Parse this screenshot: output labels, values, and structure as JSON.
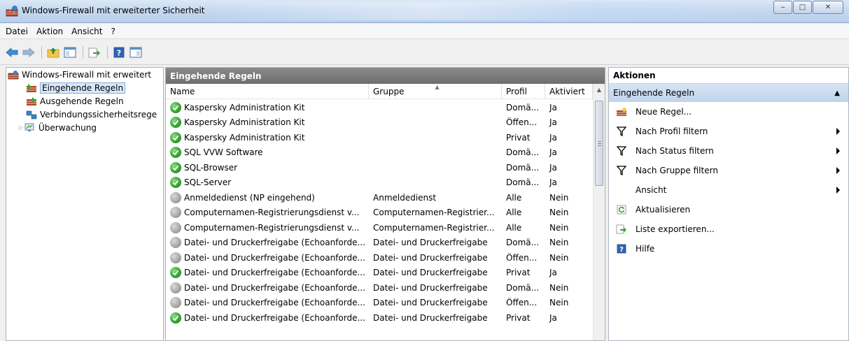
{
  "window": {
    "title": "Windows-Firewall mit erweiterter Sicherheit",
    "buttons": {
      "minimize": "‒",
      "maximize": "□",
      "close": "✕"
    }
  },
  "menu": [
    "Datei",
    "Aktion",
    "Ansicht",
    "?"
  ],
  "toolbar": {
    "icons": [
      "back-arrow-icon",
      "forward-arrow-icon",
      "up-folder-icon",
      "show-hide-console-tree-icon",
      "export-list-icon",
      "help-icon",
      "show-hide-action-pane-icon"
    ]
  },
  "tree": {
    "root": "Windows-Firewall mit erweitert",
    "items": [
      {
        "label": "Eingehende Regeln",
        "selected": true
      },
      {
        "label": "Ausgehende Regeln",
        "selected": false
      },
      {
        "label": "Verbindungssicherheitsrege",
        "selected": false
      },
      {
        "label": "Überwachung",
        "selected": false,
        "expandable": true
      }
    ]
  },
  "main": {
    "header": "Eingehende Regeln",
    "columns": [
      "Name",
      "Gruppe",
      "Profil",
      "Aktiviert"
    ],
    "rows": [
      {
        "name": "Kaspersky Administration Kit",
        "group": "",
        "profile": "Domä...",
        "active": "Ja",
        "enabled": true
      },
      {
        "name": "Kaspersky Administration Kit",
        "group": "",
        "profile": "Öffen...",
        "active": "Ja",
        "enabled": true
      },
      {
        "name": "Kaspersky Administration Kit",
        "group": "",
        "profile": "Privat",
        "active": "Ja",
        "enabled": true
      },
      {
        "name": "SQL VVW Software",
        "group": "",
        "profile": "Domä...",
        "active": "Ja",
        "enabled": true
      },
      {
        "name": "SQL-Browser",
        "group": "",
        "profile": "Domä...",
        "active": "Ja",
        "enabled": true
      },
      {
        "name": "SQL-Server",
        "group": "",
        "profile": "Domä...",
        "active": "Ja",
        "enabled": true
      },
      {
        "name": "Anmeldedienst (NP eingehend)",
        "group": "Anmeldedienst",
        "profile": "Alle",
        "active": "Nein",
        "enabled": false
      },
      {
        "name": "Computernamen-Registrierungsdienst v...",
        "group": "Computernamen-Registrier...",
        "profile": "Alle",
        "active": "Nein",
        "enabled": false
      },
      {
        "name": "Computernamen-Registrierungsdienst v...",
        "group": "Computernamen-Registrier...",
        "profile": "Alle",
        "active": "Nein",
        "enabled": false
      },
      {
        "name": "Datei- und Druckerfreigabe (Echoanforde...",
        "group": "Datei- und Druckerfreigabe",
        "profile": "Domä...",
        "active": "Nein",
        "enabled": false
      },
      {
        "name": "Datei- und Druckerfreigabe (Echoanforde...",
        "group": "Datei- und Druckerfreigabe",
        "profile": "Öffen...",
        "active": "Nein",
        "enabled": false
      },
      {
        "name": "Datei- und Druckerfreigabe (Echoanforde...",
        "group": "Datei- und Druckerfreigabe",
        "profile": "Privat",
        "active": "Ja",
        "enabled": true
      },
      {
        "name": "Datei- und Druckerfreigabe (Echoanforde...",
        "group": "Datei- und Druckerfreigabe",
        "profile": "Domä...",
        "active": "Nein",
        "enabled": false
      },
      {
        "name": "Datei- und Druckerfreigabe (Echoanforde...",
        "group": "Datei- und Druckerfreigabe",
        "profile": "Öffen...",
        "active": "Nein",
        "enabled": false
      },
      {
        "name": "Datei- und Druckerfreigabe (Echoanforde...",
        "group": "Datei- und Druckerfreigabe",
        "profile": "Privat",
        "active": "Ja",
        "enabled": true
      }
    ]
  },
  "actions": {
    "title": "Aktionen",
    "section": "Eingehende Regeln",
    "items": [
      {
        "label": "Neue Regel...",
        "icon": "new-rule-icon",
        "submenu": false
      },
      {
        "label": "Nach Profil filtern",
        "icon": "filter-icon",
        "submenu": true
      },
      {
        "label": "Nach Status filtern",
        "icon": "filter-icon",
        "submenu": true
      },
      {
        "label": "Nach Gruppe filtern",
        "icon": "filter-icon",
        "submenu": true
      },
      {
        "label": "Ansicht",
        "icon": "",
        "submenu": true
      },
      {
        "label": "Aktualisieren",
        "icon": "refresh-icon",
        "submenu": false
      },
      {
        "label": "Liste exportieren...",
        "icon": "export-list-icon",
        "submenu": false
      },
      {
        "label": "Hilfe",
        "icon": "help-icon",
        "submenu": false
      }
    ]
  },
  "colors": {
    "enabled_icon": "#3aa234",
    "disabled_icon": "#a5a5a5",
    "pane_header": "#6e6e6e",
    "action_section": "#c1d4ec",
    "selection": "#d9e8fb"
  }
}
